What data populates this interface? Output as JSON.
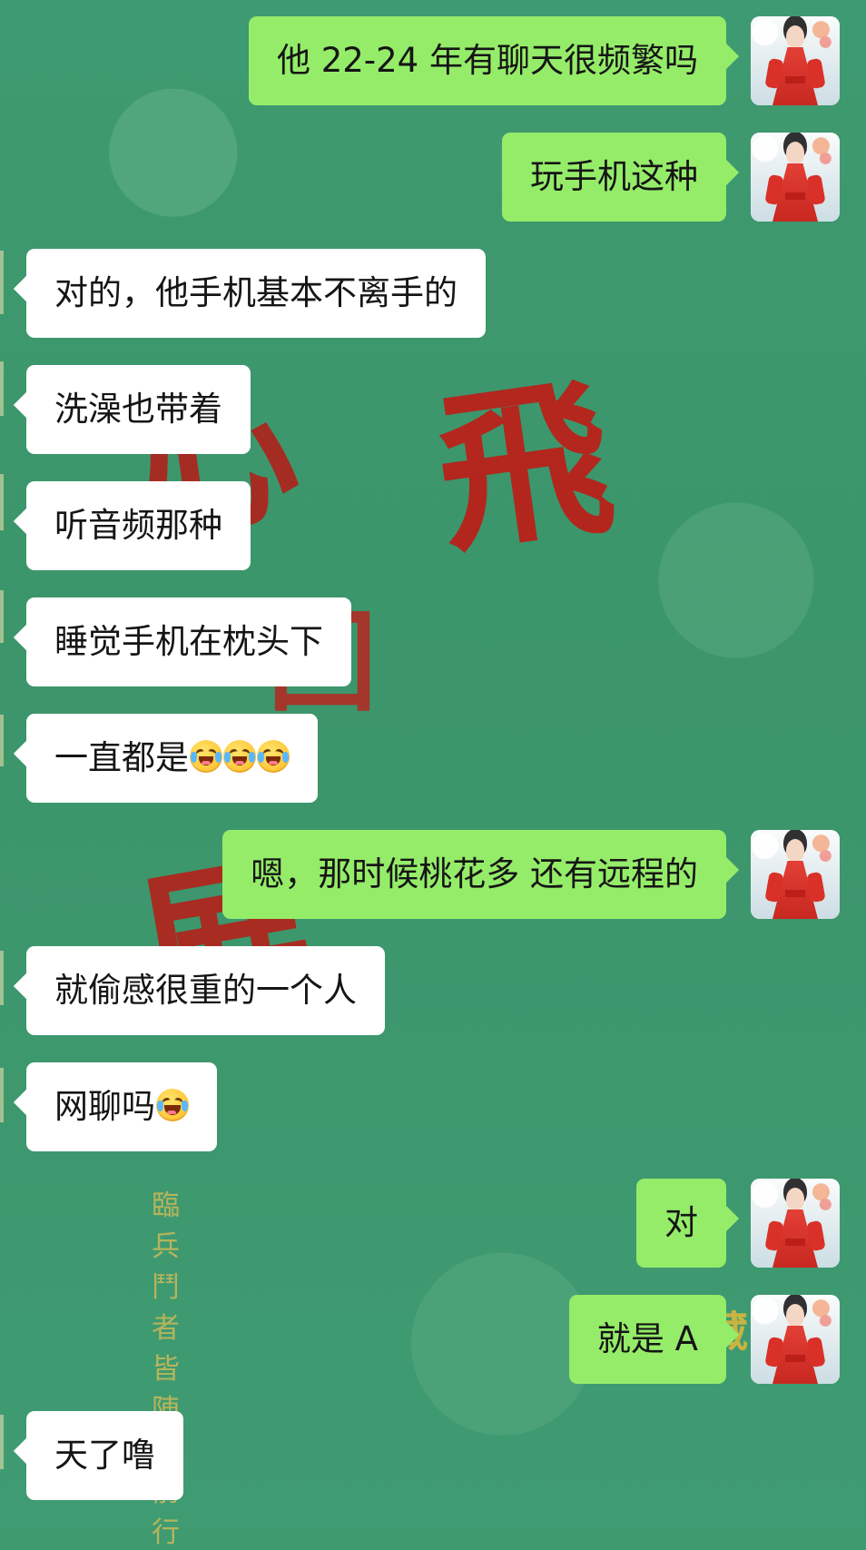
{
  "chat": {
    "messages": [
      {
        "side": "right",
        "text": "他 22-24 年有聊天很频繁吗"
      },
      {
        "side": "right",
        "text": "玩手机这种"
      },
      {
        "side": "left",
        "text": "对的，他手机基本不离手的"
      },
      {
        "side": "left",
        "text": "洗澡也带着"
      },
      {
        "side": "left",
        "text": "听音频那种"
      },
      {
        "side": "left",
        "text": "睡觉手机在枕头下"
      },
      {
        "side": "left",
        "text": "一直都是",
        "emoji": [
          "loudly-crying-face",
          "loudly-crying-face",
          "loudly-crying-face"
        ]
      },
      {
        "side": "right",
        "text": "嗯，那时候桃花多 还有远程的"
      },
      {
        "side": "left",
        "text": "就偷感很重的一个人"
      },
      {
        "side": "left",
        "text": "网聊吗",
        "emoji": [
          "face-with-tears-of-joy"
        ]
      },
      {
        "side": "right",
        "text": "对"
      },
      {
        "side": "right",
        "text": "就是 A"
      },
      {
        "side": "left",
        "text": "天了噜"
      }
    ]
  },
  "background": {
    "ornament_text": "臨 兵 鬥 者 皆 陣 列 前 行",
    "decor_glyphs": [
      "飛",
      "心",
      "回",
      "展",
      "蠱藏"
    ]
  },
  "colors": {
    "background": "#3f9a70",
    "sent_bubble": "#95ec69",
    "received_bubble": "#ffffff",
    "text": "#151515",
    "red_calligraphy": "#c11e18",
    "gold_text": "#dcbc55"
  },
  "icons": {
    "sender_avatar": "avatar-woman-red-dress-icon",
    "loudly_crying": "loudly-crying-face-icon",
    "tears_of_joy": "face-with-tears-of-joy-icon"
  }
}
